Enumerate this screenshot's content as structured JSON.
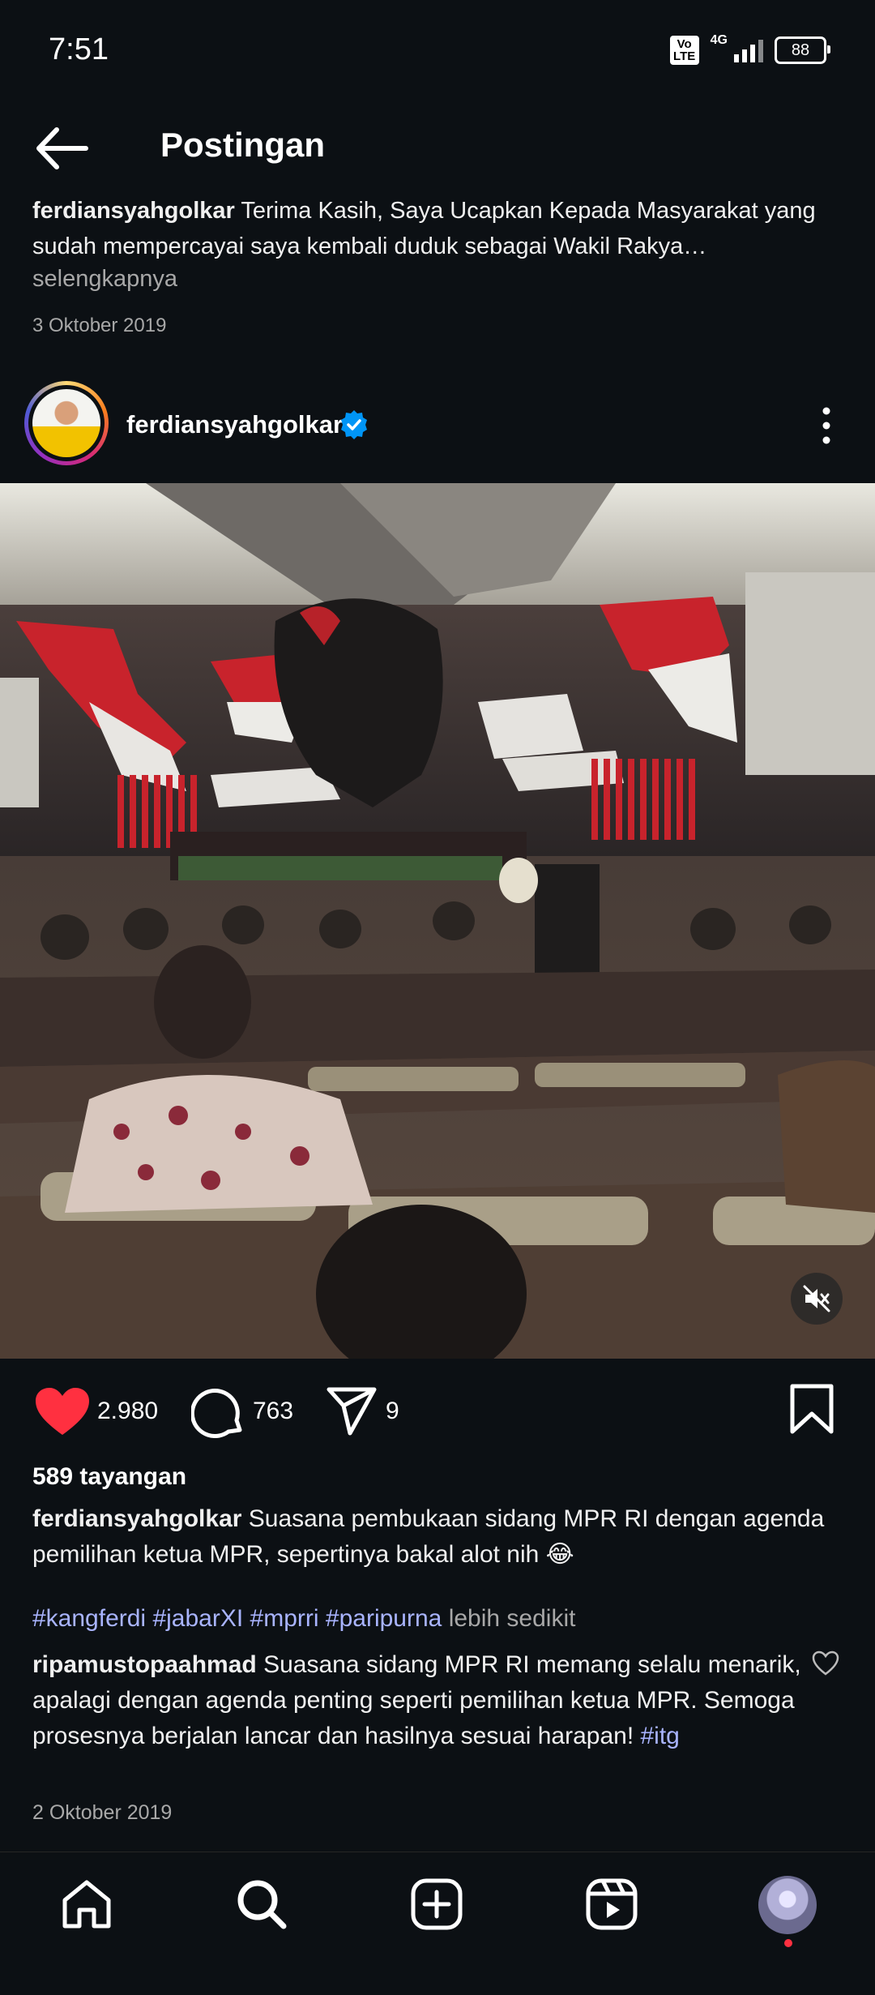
{
  "status_bar": {
    "time": "7:51",
    "volte": "Vo LTE",
    "network": "4G",
    "battery": "88"
  },
  "header": {
    "title": "Postingan",
    "back_icon": "arrow-left-icon"
  },
  "previous_post": {
    "username": "ferdiansyahgolkar",
    "caption": "Terima Kasih, Saya Ucapkan Kepada Masyarakat yang sudah mempercayai saya kembali duduk sebagai Wakil Rakya…",
    "more": "selengkapnya",
    "date": "3 Oktober 2019"
  },
  "post": {
    "username": "ferdiansyahgolkar",
    "verified_icon": "verified-badge-icon",
    "menu_icon": "more-vertical-icon",
    "media_alt": "video",
    "likes": "2.980",
    "comments": "763",
    "shares": "9",
    "views": "589 tayangan",
    "caption_user": "ferdiansyahgolkar",
    "caption_text": "Suasana pembukaan sidang MPR RI dengan agenda pemilihan ketua MPR, sepertinya bakal alot nih 😂",
    "hashtags": [
      "#kangferdi",
      "#jabarXI",
      "#mprri",
      "#paripurna"
    ],
    "less": "lebih sedikit",
    "top_comment": {
      "user": "ripamustopaahmad",
      "text": "Suasana sidang MPR RI memang selalu menarik, apalagi dengan agenda penting seperti pemilihan ketua MPR. Semoga prosesnya berjalan lancar dan hasilnya sesuai harapan!",
      "tag": "#itg"
    },
    "date": "2 Oktober 2019"
  },
  "colors": {
    "background": "#0c1014",
    "like": "#ff3040",
    "hashtag": "#a9b4ff",
    "verified": "#0095f6",
    "muted_text": "#a8a8a8"
  },
  "bottom_nav": {
    "items": [
      "home-icon",
      "search-icon",
      "create-icon",
      "reels-icon",
      "profile-avatar"
    ]
  }
}
